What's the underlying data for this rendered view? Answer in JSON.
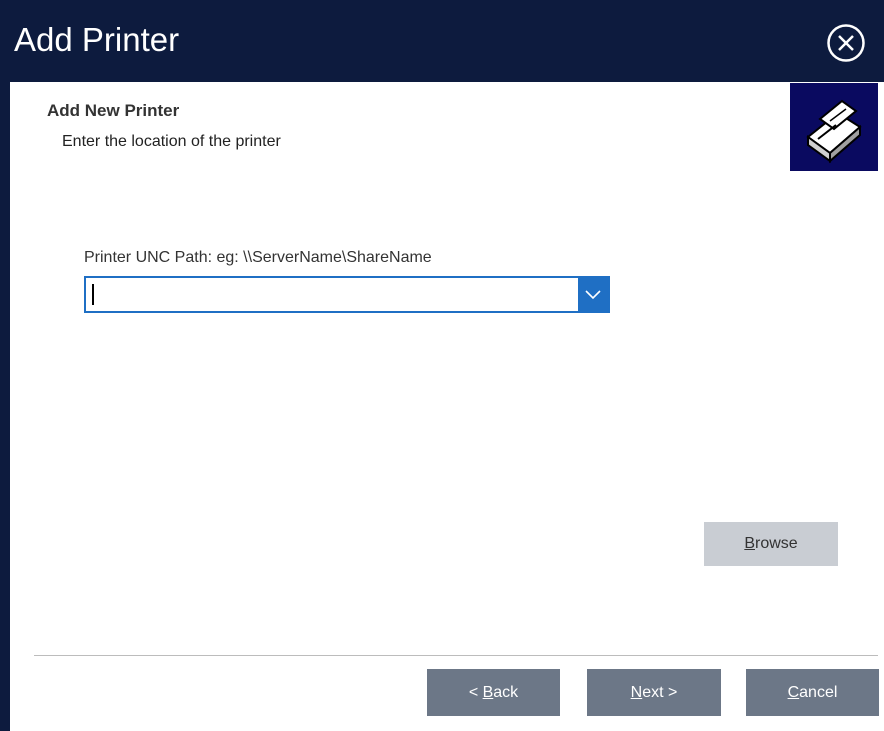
{
  "window": {
    "title": "Add Printer",
    "close_icon": "close-circle-icon"
  },
  "header": {
    "title": "Add New Printer",
    "subtitle": "Enter the location of the printer",
    "icon": "printer-icon"
  },
  "form": {
    "path_label": "Printer UNC Path: eg: \\\\ServerName\\ShareName",
    "path_value": "",
    "dropdown_icon": "chevron-down-icon"
  },
  "buttons": {
    "browse": {
      "prefix": "",
      "mnemonic": "B",
      "rest": "rowse"
    },
    "back": {
      "prefix": "< ",
      "mnemonic": "B",
      "rest": "ack"
    },
    "next": {
      "prefix": "",
      "mnemonic": "N",
      "rest": "ext >"
    },
    "cancel": {
      "prefix": "",
      "mnemonic": "C",
      "rest": "ancel"
    }
  },
  "colors": {
    "titlebar": "#0d1b3e",
    "accent": "#1f6fc4",
    "footer_button": "#6c7787",
    "disabled_button": "#c9cdd3"
  }
}
